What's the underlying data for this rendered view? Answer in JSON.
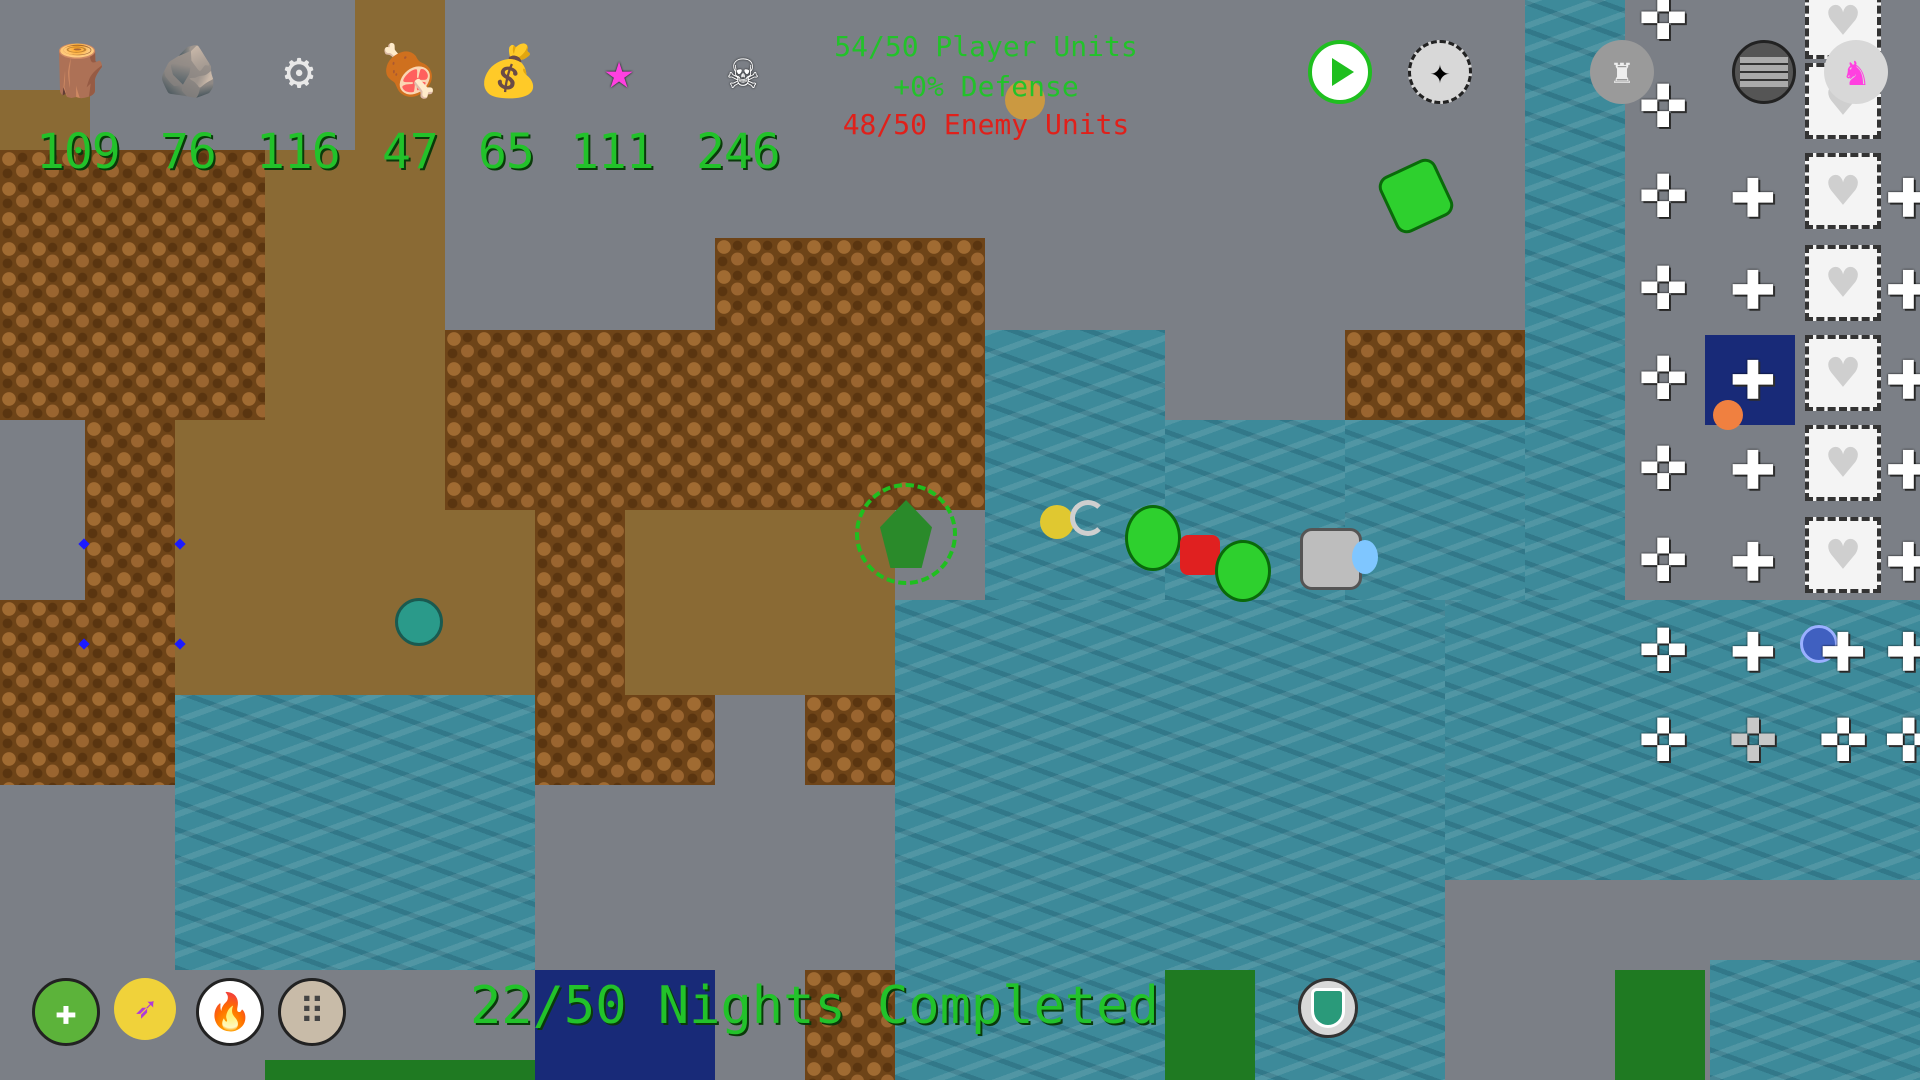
{
  "resources": [
    {
      "name": "wood",
      "icon": "wood-logs-icon",
      "glyph": "🪵",
      "value": "109"
    },
    {
      "name": "stone",
      "icon": "stone-slab-icon",
      "glyph": "🪨",
      "value": "76"
    },
    {
      "name": "metal",
      "icon": "metal-gear-icon",
      "glyph": "⚙",
      "value": "116"
    },
    {
      "name": "meat",
      "icon": "red-meat-icon",
      "glyph": "🍖",
      "value": "47"
    },
    {
      "name": "gold",
      "icon": "gold-ore-icon",
      "glyph": "💰",
      "value": "65"
    },
    {
      "name": "mana",
      "icon": "pink-star-icon",
      "glyph": "★",
      "value": "111"
    },
    {
      "name": "kills",
      "icon": "skull-icon",
      "glyph": "☠",
      "value": "246"
    }
  ],
  "status": {
    "player_units": "54/50 Player Units",
    "defense": "+0% Defense",
    "enemy_units": "48/50 Enemy Units"
  },
  "top_buttons": {
    "play_icon": "play-button-icon",
    "creature_icon": "creature-summon-icon",
    "unit_icon": "gray-unit-icon",
    "wall_icon": "brick-wall-icon",
    "unicorn_icon": "unicorn-icon"
  },
  "nights": "22/50 Nights Completed",
  "abilities": [
    {
      "name": "heal-ability",
      "glyph": "✚",
      "bg": "#5cb33a"
    },
    {
      "name": "arrow-ability",
      "glyph": "➶",
      "bg": "#f0d23a"
    },
    {
      "name": "fire-ability",
      "glyph": "🔥",
      "bg": "#ffffff"
    },
    {
      "name": "rubble-ability",
      "glyph": "⠿",
      "bg": "#c8bba8"
    }
  ],
  "shield_icon": "shield-icon",
  "colors": {
    "hud_green": "#22c22a",
    "enemy_red": "#e0201a",
    "dirt": "#8a6a34",
    "water": "#3d8a9a"
  }
}
